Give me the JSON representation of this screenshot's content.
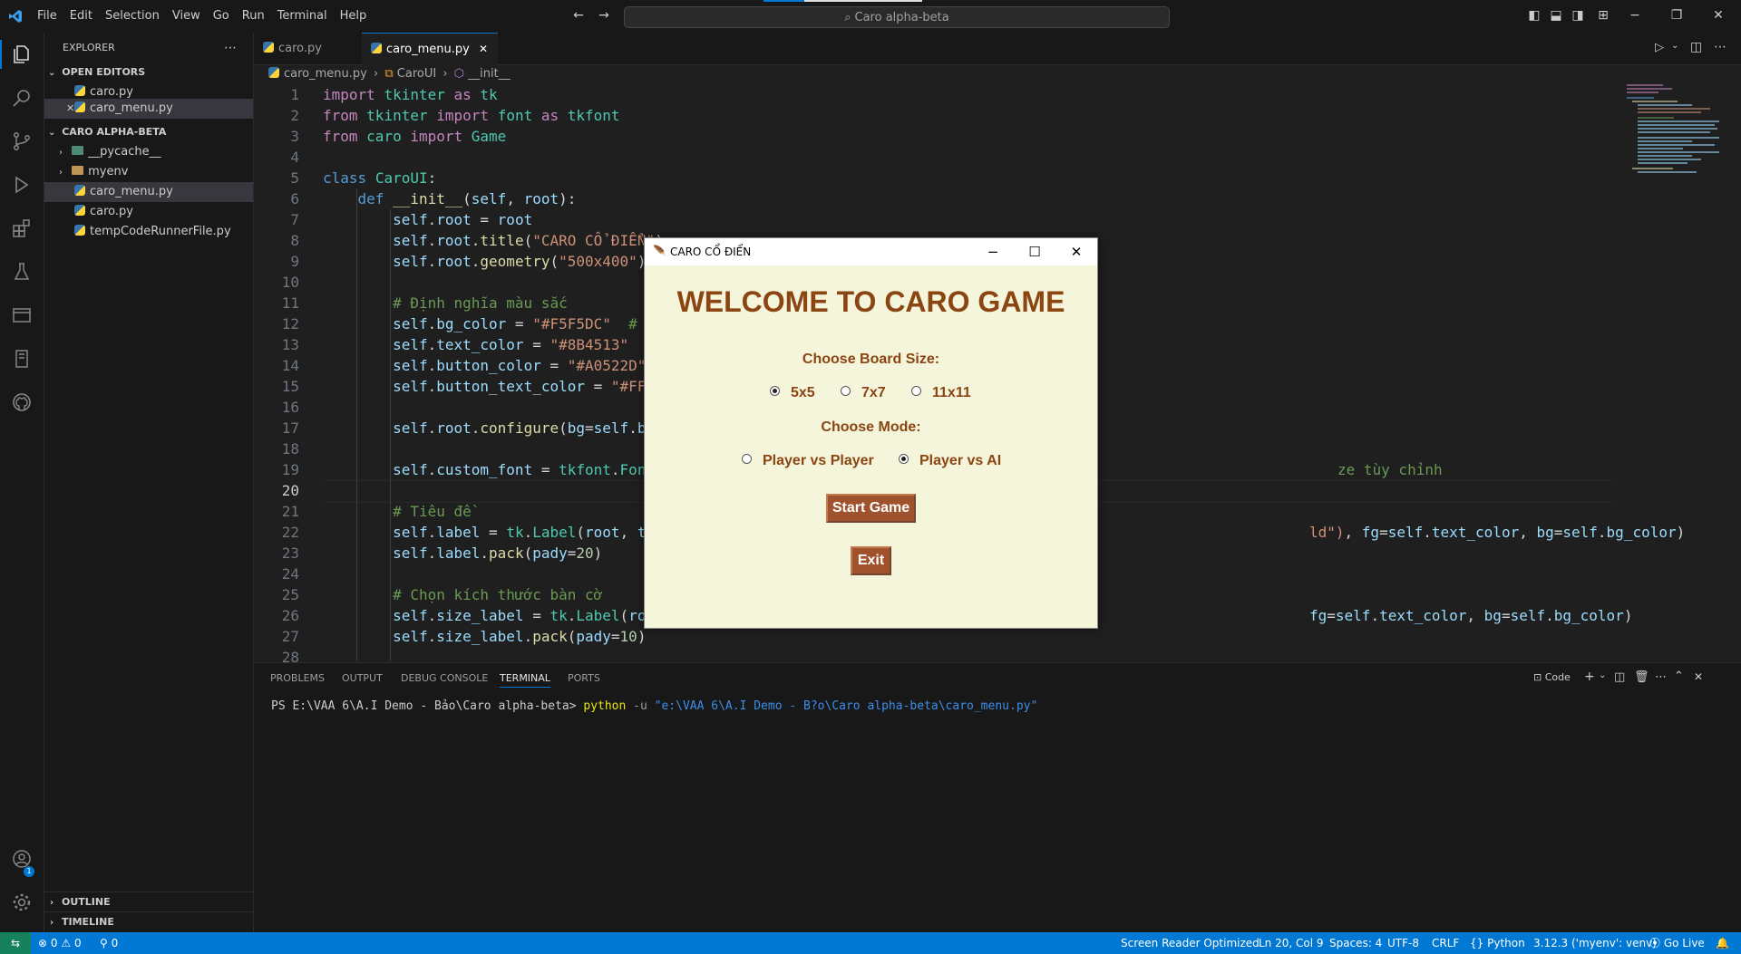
{
  "menubar": [
    "File",
    "Edit",
    "Selection",
    "View",
    "Go",
    "Run",
    "Terminal",
    "Help"
  ],
  "search": {
    "text": "Caro alpha-beta"
  },
  "sidebar": {
    "title": "EXPLORER",
    "open_editors_label": "OPEN EDITORS",
    "open_editors": [
      "caro.py",
      "caro_menu.py"
    ],
    "project_label": "CARO ALPHA-BETA",
    "items": [
      "__pycache__",
      "myenv",
      "caro_menu.py",
      "caro.py",
      "tempCodeRunnerFile.py"
    ],
    "outline_label": "OUTLINE",
    "timeline_label": "TIMELINE"
  },
  "tabs": [
    "caro.py",
    "caro_menu.py"
  ],
  "breadcrumb": {
    "file": "caro_menu.py",
    "cls": "CaroUI",
    "method": "__init__"
  },
  "code_lines": [
    {
      "n": "1",
      "t": "import tkinter as tk"
    },
    {
      "n": "2",
      "t": "from tkinter import font as tkfont"
    },
    {
      "n": "3",
      "t": "from caro import Game"
    },
    {
      "n": "4",
      "t": ""
    },
    {
      "n": "5",
      "t": "class CaroUI:"
    },
    {
      "n": "6",
      "t": "    def __init__(self, root):"
    },
    {
      "n": "7",
      "t": "        self.root = root"
    },
    {
      "n": "8",
      "t": "        self.root.title(\"CARO CỔ ĐIỂN\")"
    },
    {
      "n": "9",
      "t": "        self.root.geometry(\"500x400\")"
    },
    {
      "n": "10",
      "t": ""
    },
    {
      "n": "11",
      "t": "        # Định nghĩa màu sắc"
    },
    {
      "n": "12",
      "t": "        self.bg_color = \"#F5F5DC\"  # B"
    },
    {
      "n": "13",
      "t": "        self.text_color = \"#8B4513\"  #"
    },
    {
      "n": "14",
      "t": "        self.button_color = \"#A0522D\""
    },
    {
      "n": "15",
      "t": "        self.button_text_color = \"#FFF"
    },
    {
      "n": "16",
      "t": ""
    },
    {
      "n": "17",
      "t": "        self.root.configure(bg=self.bg"
    },
    {
      "n": "18",
      "t": ""
    },
    {
      "n": "19",
      "t": "        self.custom_font = tkfont.Font"
    },
    {
      "n": "20",
      "t": ""
    },
    {
      "n": "21",
      "t": "        # Tiêu đề"
    },
    {
      "n": "22",
      "t": "        self.label = tk.Label(root, te"
    },
    {
      "n": "23",
      "t": "        self.label.pack(pady=20)"
    },
    {
      "n": "24",
      "t": ""
    },
    {
      "n": "25",
      "t": "        # Chọn kích thước bàn cờ"
    },
    {
      "n": "26",
      "t": "        self.size_label = tk.Label(roo"
    },
    {
      "n": "27",
      "t": "        self.size_label.pack(pady=10)"
    },
    {
      "n": "28",
      "t": ""
    }
  ],
  "code_tails": {
    "l19": "ze tùy chỉnh",
    "l22": "ld\"), fg=self.text_color, bg=self.bg_color)",
    "l26": "fg=self.text_color, bg=self.bg_color)"
  },
  "panel": {
    "tabs": [
      "PROBLEMS",
      "OUTPUT",
      "DEBUG CONSOLE",
      "TERMINAL",
      "PORTS"
    ],
    "terminal_prompt": "PS E:\\VAA 6\\A.I Demo - Bảo\\Caro alpha-beta>",
    "terminal_cmd": "python",
    "terminal_flag": "-u",
    "terminal_arg": "\"e:\\VAA 6\\A.I Demo - B?o\\Caro alpha-beta\\caro_menu.py\"",
    "code_label": "Code"
  },
  "status": {
    "errors": "0",
    "warnings": "0",
    "ports": "0",
    "screen_reader": "Screen Reader Optimized",
    "position": "Ln 20, Col 9",
    "spaces": "Spaces: 4",
    "encoding": "UTF-8",
    "eol": "CRLF",
    "language": "Python",
    "interpreter": "3.12.3 ('myenv': venv)",
    "golive": "Go Live"
  },
  "tkwindow": {
    "title": "CARO CỔ ĐIỂN",
    "heading": "WELCOME TO CARO GAME",
    "board_label": "Choose Board Size:",
    "board_options": [
      "5x5",
      "7x7",
      "11x11"
    ],
    "board_selected": "5x5",
    "mode_label": "Choose Mode:",
    "mode_options": [
      "Player vs Player",
      "Player vs AI"
    ],
    "mode_selected": "Player vs AI",
    "start_label": "Start Game",
    "exit_label": "Exit",
    "bg_color": "#F5F5DC",
    "text_color": "#8B4513",
    "button_color": "#A0522D"
  }
}
